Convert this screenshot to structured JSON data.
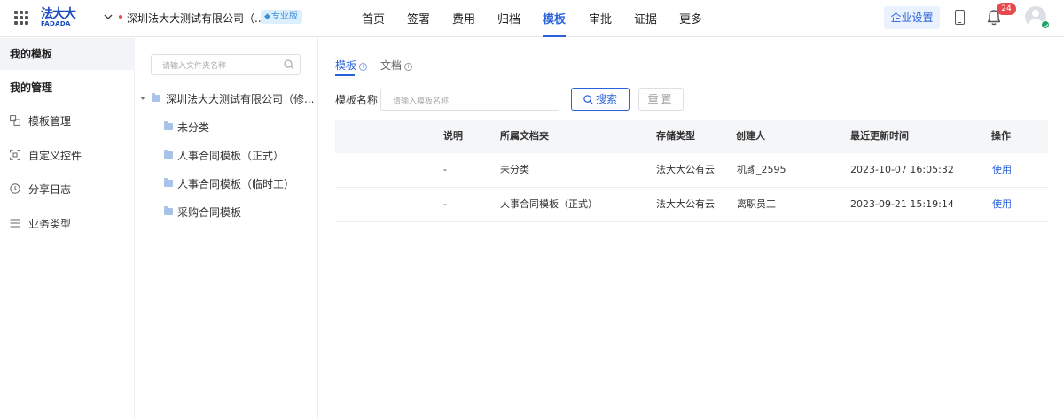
{
  "header": {
    "logo_cn": "法大大",
    "logo_en": "FADADA",
    "company_name": "深圳法大大测试有限公司（...",
    "edition": "专业版",
    "nav": [
      {
        "label": "首页",
        "active": false
      },
      {
        "label": "签署",
        "active": false
      },
      {
        "label": "费用",
        "active": false
      },
      {
        "label": "归档",
        "active": false
      },
      {
        "label": "模板",
        "active": true
      },
      {
        "label": "审批",
        "active": false
      },
      {
        "label": "证据",
        "active": false
      },
      {
        "label": "更多",
        "active": false
      }
    ],
    "settings_label": "企业设置",
    "notification_count": "24"
  },
  "sidebar": {
    "items": [
      {
        "label": "我的模板",
        "type": "head",
        "selected": true
      },
      {
        "label": "我的管理",
        "type": "head",
        "selected": false
      },
      {
        "label": "模板管理",
        "type": "item",
        "icon": "template-manage-icon"
      },
      {
        "label": "自定义控件",
        "type": "item",
        "icon": "custom-control-icon"
      },
      {
        "label": "分享日志",
        "type": "item",
        "icon": "clock-icon"
      },
      {
        "label": "业务类型",
        "type": "item",
        "icon": "list-icon"
      }
    ]
  },
  "tree": {
    "search_placeholder": "请输入文件夹名称",
    "root": "深圳法大大测试有限公司（修...",
    "children": [
      "未分类",
      "人事合同模板（正式）",
      "人事合同模板（临时工）",
      "采购合同模板"
    ]
  },
  "main": {
    "tabs": [
      {
        "label": "模板",
        "active": true
      },
      {
        "label": "文档",
        "active": false
      }
    ],
    "filter": {
      "label": "模板名称",
      "placeholder": "请输入模板名称",
      "search_label": "搜索",
      "reset_label": "重置"
    },
    "table": {
      "columns": [
        "",
        "说明",
        "所属文档夹",
        "存储类型",
        "创建人",
        "最近更新时间",
        "操作"
      ],
      "rows": [
        [
          "",
          "-",
          "未分类",
          "法大大公有云",
          "机豸_2595",
          "2023-10-07 16:05:32",
          "使用"
        ],
        [
          "",
          "-",
          "人事合同模板（正式）",
          "法大大公有云",
          "离职员工",
          "2023-09-21 15:19:14",
          "使用"
        ]
      ]
    }
  },
  "colors": {
    "accent": "#2a63d9",
    "badge_red": "#e5484d",
    "edition_bg": "#dcefff"
  }
}
